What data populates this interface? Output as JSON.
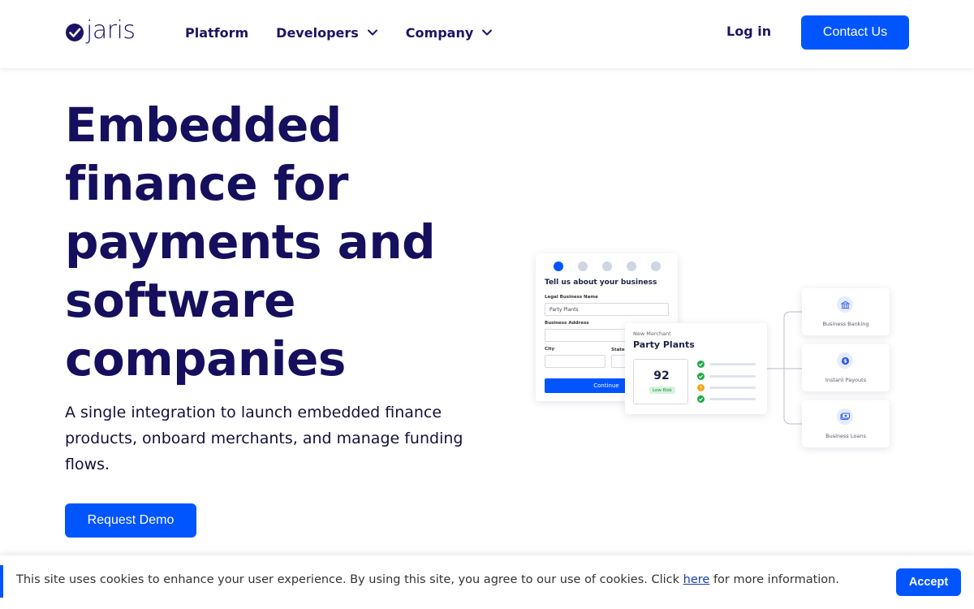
{
  "header": {
    "logo_text": "jaris",
    "nav": [
      {
        "label": "Platform",
        "has_dropdown": false
      },
      {
        "label": "Developers",
        "has_dropdown": true
      },
      {
        "label": "Company",
        "has_dropdown": true
      }
    ],
    "login_label": "Log in",
    "contact_label": "Contact Us"
  },
  "hero": {
    "title": "Embedded finance for payments and software companies",
    "subtitle": "A single integration to launch embedded finance products, onboard merchants, and manage funding flows.",
    "cta_label": "Request Demo"
  },
  "illustration": {
    "form": {
      "title": "Tell us about your business",
      "legal_name_label": "Legal Business Name",
      "legal_name_value": "Party Plants",
      "address_label": "Business Address",
      "city_label": "City",
      "state_label": "State",
      "continue_label": "Continue"
    },
    "merchant": {
      "caption": "New Merchant",
      "name": "Party Plants",
      "score": "92",
      "risk": "Low Risk"
    },
    "products": [
      {
        "label": "Business Banking",
        "icon": "bank-icon"
      },
      {
        "label": "Instant Payouts",
        "icon": "dollar-icon"
      },
      {
        "label": "Business Loans",
        "icon": "cash-icon"
      }
    ]
  },
  "cookie": {
    "text_before": "This site uses cookies to enhance your user experience. By using this site, you agree to our use of cookies. Click ",
    "link": "here",
    "text_after": " for more information.",
    "accept_label": "Accept"
  },
  "colors": {
    "brand_blue": "#0055ff",
    "navy": "#160f5e"
  }
}
